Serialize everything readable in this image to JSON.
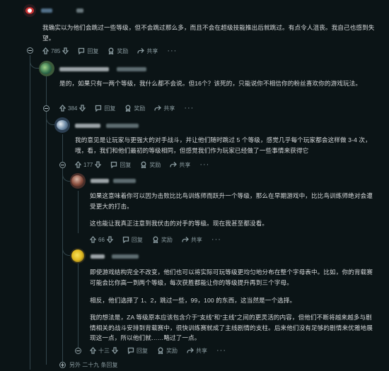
{
  "comments": [
    {
      "text": "我确实以为他们会跳过一些等级，但不会跳过那么多，而且不会在超级技能推出后就跳过。有点令人沮丧。我自己也感到失望。",
      "votes": "785",
      "reply": "回复",
      "award": "奖励",
      "share": "共享"
    },
    {
      "text": "是的，如果只有一两个等级，我什么都不会说。但16个？该死的，只能说你不相信你的粉丝喜欢你的游戏玩法。",
      "votes": "384",
      "reply": "回复",
      "award": "奖励",
      "share": "共享"
    },
    {
      "text": "我的意见是让玩家与更强大的对手战斗，并让他们随时跳过 5 个等级，感觉几乎每个玩家都会这样做 3-4 次，哦，看，我们和他们最初的等级相同，但感觉我们作为玩家已经做了一些事情来获得它",
      "votes": "177",
      "reply": "回复",
      "award": "奖励",
      "share": "共享"
    },
    {
      "text1": "如果这意味着你可以因为击败比比鸟训练师而跃升一个等级，那么在早期游戏中，比比鸟训练师绝对会遭受更大的打击。",
      "text2": "这也能让我真正注意到我伏击的对手的等级。现在我甚至都没看。",
      "votes": "66",
      "reply": "回复",
      "award": "奖励",
      "share": "共享"
    },
    {
      "text1": "即使游戏结构完全不改变，他们也可以将实际可玩等级更均匀地分布在整个字母表中。比如，你的背载赛可能会比你高一到两个等级，每次获胜都能让你的等级提升再到三个字母。",
      "text2": "相反，他们选择了 1、2，跳过一些，99，100 的东西，这当然是一个选择。",
      "text3": "我的想法是，ZA 等级原本应该包含介于“支线”和“主线”之间的更灵活的内容，但他们不断将越来越多与剧情相关的战斗安排到背载赛中，很快训练赛就成了主线剧情的支柱。后来他们没有足够的剧情来优雅地展现这一点，所以他们就……略过了一点。",
      "votes": "十三",
      "reply": "回复",
      "award": "奖励",
      "share": "共享"
    }
  ],
  "more_replies": "另外 二十九 条回复",
  "colors": {
    "background": "#0b1416",
    "text": "#d7dadc",
    "muted": "#8a9ba0",
    "line": "#33464c"
  }
}
